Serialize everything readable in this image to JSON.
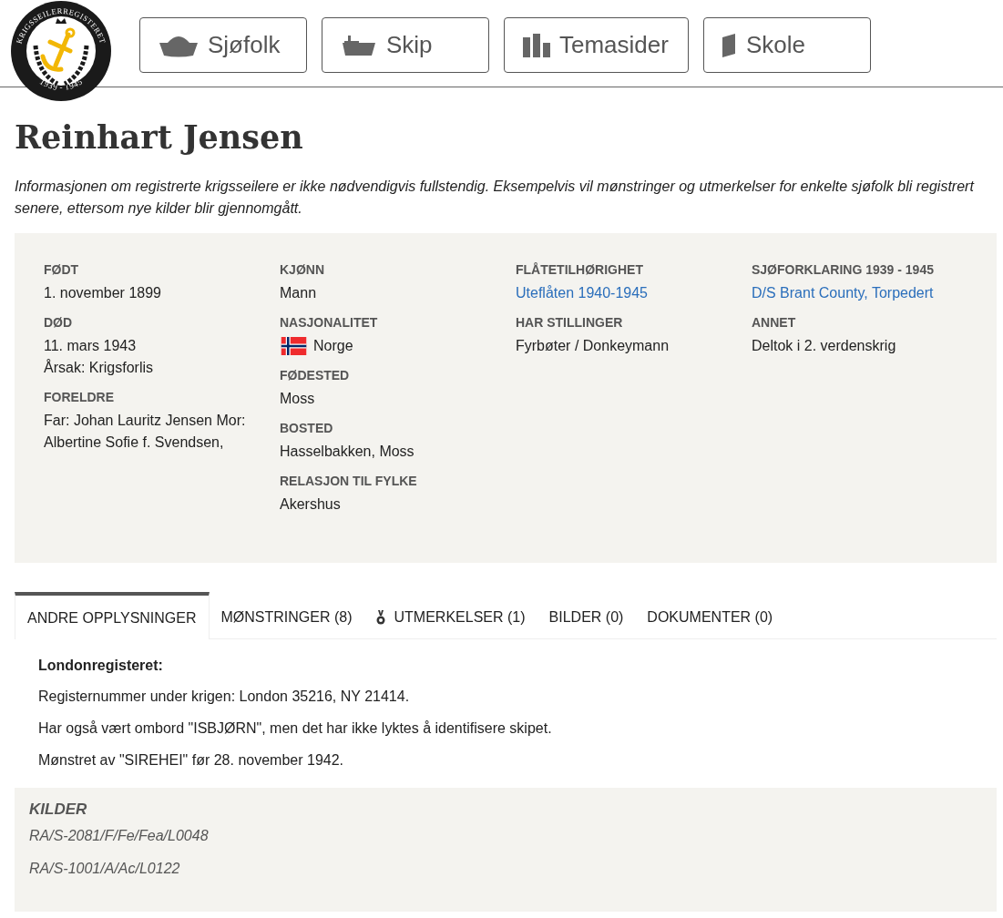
{
  "logo": {
    "ring_text": "KRIGSSEILERREGISTERET",
    "years": "1939 - 1945"
  },
  "nav": [
    {
      "label": "Sjøfolk",
      "kind": "cap"
    },
    {
      "label": "Skip",
      "kind": "ship"
    },
    {
      "label": "Temasider",
      "kind": "bars"
    },
    {
      "label": "Skole",
      "kind": "book"
    }
  ],
  "title": "Reinhart Jensen",
  "notice": "Informasjonen om registrerte krigsseilere er ikke nødvendigvis fullstendig. Eksempelvis vil mønstringer og utmerkelser for enkelte sjøfolk bli registrert senere, ettersom nye kilder blir gjennomgått.",
  "facts": [
    [
      {
        "label": "FØDT",
        "kind": "text",
        "lines": [
          "1. november 1899"
        ]
      },
      {
        "label": "DØD",
        "kind": "text",
        "lines": [
          "11. mars 1943",
          "Årsak: Krigsforlis"
        ]
      },
      {
        "label": "FORELDRE",
        "kind": "text",
        "lines": [
          "Far: Johan Lauritz Jensen Mor: Albertine Sofie f. Svendsen,"
        ]
      }
    ],
    [
      {
        "label": "KJØNN",
        "kind": "text",
        "lines": [
          "Mann"
        ]
      },
      {
        "label": "NASJONALITET",
        "kind": "flag",
        "lines": [
          "Norge"
        ]
      },
      {
        "label": "FØDESTED",
        "kind": "text",
        "lines": [
          "Moss"
        ]
      },
      {
        "label": "BOSTED",
        "kind": "text",
        "lines": [
          "Hasselbakken, Moss"
        ]
      },
      {
        "label": "RELASJON TIL FYLKE",
        "kind": "text",
        "lines": [
          "Akershus"
        ]
      }
    ],
    [
      {
        "label": "FLÅTETILHØRIGHET",
        "kind": "link",
        "lines": [
          "Uteflåten 1940-1945"
        ]
      },
      {
        "label": "HAR STILLINGER",
        "kind": "text",
        "lines": [
          "Fyrbøter / Donkeymann"
        ]
      }
    ],
    [
      {
        "label": "SJØFORKLARING 1939 - 1945",
        "kind": "link",
        "lines": [
          "D/S Brant County, Torpedert"
        ]
      },
      {
        "label": "ANNET",
        "kind": "text",
        "lines": [
          "Deltok i 2. verdenskrig"
        ]
      }
    ]
  ],
  "tabs": [
    {
      "label": "ANDRE OPPLYSNINGER",
      "selected": true
    },
    {
      "label": "MØNSTRINGER (8)",
      "selected": false
    },
    {
      "label": "UTMERKELSER (1)",
      "selected": false,
      "kind": "medal"
    },
    {
      "label": "BILDER (0)",
      "selected": false
    },
    {
      "label": "DOKUMENTER (0)",
      "selected": false
    }
  ],
  "tab_content": {
    "heading": "Londonregisteret:",
    "paragraphs": [
      "Registernummer under krigen: London 35216, NY 21414.",
      "Har også vært ombord \"ISBJØRN\", men det har ikke lyktes å identifisere skipet.",
      "Mønstret av \"SIREHEI\" før 28. november 1942."
    ]
  },
  "sources": {
    "heading": "KILDER",
    "items": [
      "RA/S-2081/F/Fe/Fea/L0048",
      "RA/S-1001/A/Ac/L0122"
    ]
  }
}
